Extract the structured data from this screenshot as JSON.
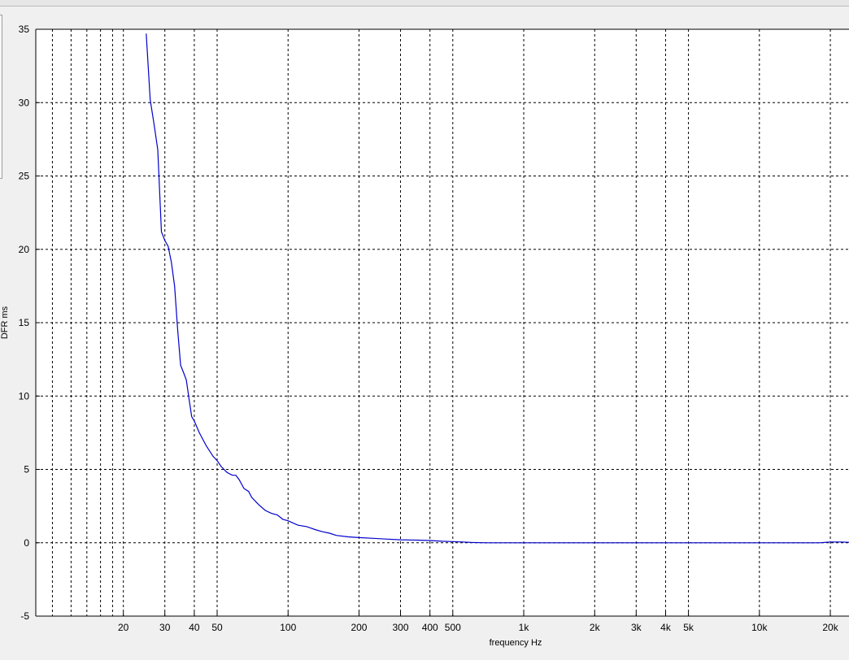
{
  "chart_data": {
    "type": "line",
    "xlabel": "frequency   Hz",
    "ylabel": "DFR ms",
    "xscale": "log",
    "xlim": [
      8.5,
      24000
    ],
    "ylim": [
      -5,
      35
    ],
    "grid": true,
    "line_color": "#0000cc",
    "y_ticks": [
      -5,
      0,
      5,
      10,
      15,
      20,
      25,
      30,
      35
    ],
    "y_tick_labels": [
      "-5",
      "0",
      "5",
      "10",
      "15",
      "20",
      "25",
      "30",
      "35"
    ],
    "x_ticks": [
      20,
      30,
      40,
      50,
      100,
      200,
      300,
      400,
      500,
      1000,
      2000,
      3000,
      4000,
      5000,
      10000,
      20000
    ],
    "x_tick_labels": [
      "20",
      "30",
      "40",
      "50",
      "100",
      "200",
      "300",
      "400",
      "500",
      "1k",
      "2k",
      "3k",
      "4k",
      "5k",
      "10k",
      "20k"
    ],
    "x_minor_grid": [
      10,
      12,
      14,
      16,
      18
    ],
    "series": [
      {
        "x": [
          25,
          26,
          27,
          28,
          29,
          30,
          31,
          32,
          33,
          34,
          35,
          36,
          37,
          38,
          39,
          40,
          42,
          45,
          48,
          50,
          52,
          55,
          58,
          60,
          62,
          65,
          68,
          70,
          75,
          80,
          85,
          90,
          95,
          100,
          110,
          120,
          130,
          140,
          150,
          160,
          180,
          200,
          230,
          260,
          300,
          350,
          400,
          450,
          500,
          550,
          600,
          700,
          1000,
          2000,
          5000,
          10000,
          18000,
          20000,
          22000,
          24000
        ],
        "y": [
          34.7,
          30.2,
          28.5,
          26.8,
          21.2,
          20.6,
          20.2,
          19.1,
          17.5,
          14.5,
          12.1,
          11.6,
          11.1,
          9.8,
          8.6,
          8.3,
          7.5,
          6.6,
          5.9,
          5.6,
          5.2,
          4.8,
          4.6,
          4.6,
          4.3,
          3.7,
          3.5,
          3.1,
          2.6,
          2.2,
          2.0,
          1.9,
          1.6,
          1.5,
          1.2,
          1.1,
          0.9,
          0.75,
          0.65,
          0.5,
          0.4,
          0.35,
          0.3,
          0.25,
          0.2,
          0.18,
          0.15,
          0.1,
          0.08,
          0.05,
          0.02,
          0.0,
          0.0,
          0.0,
          0.0,
          0.0,
          0.0,
          0.05,
          0.05,
          0.03
        ]
      }
    ]
  }
}
